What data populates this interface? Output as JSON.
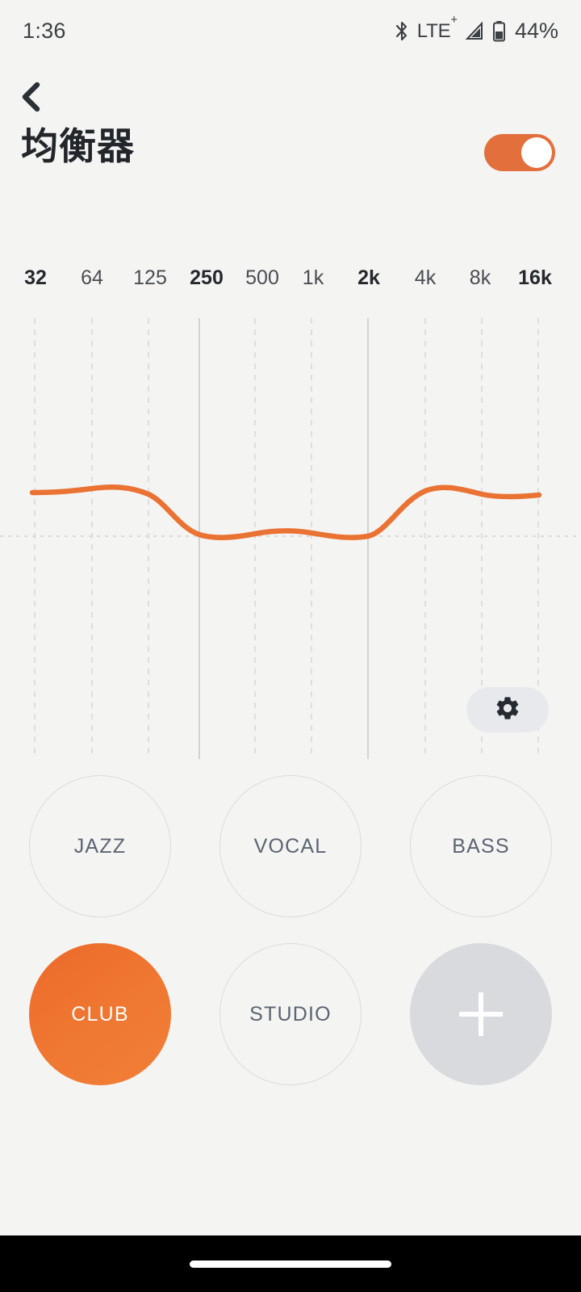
{
  "status_bar": {
    "time": "1:36",
    "bluetooth_icon": "bluetooth-icon",
    "network_label": "LTE",
    "network_superscript": "+",
    "signal_icon": "signal-bars-icon",
    "battery_icon": "battery-icon",
    "battery_percent": "44%"
  },
  "header": {
    "back_icon": "chevron-left-icon",
    "title": "均衡器",
    "toggle_state": "on",
    "toggle_color": "#e3703c"
  },
  "chart_data": {
    "type": "line",
    "title": "",
    "xlabel": "",
    "ylabel": "",
    "categories": [
      "32",
      "64",
      "125",
      "250",
      "500",
      "1k",
      "2k",
      "4k",
      "8k",
      "16k"
    ],
    "major_ticks": [
      "32",
      "250",
      "2k",
      "16k"
    ],
    "solid_gridlines": [
      "250",
      "2k"
    ],
    "values": [
      3.2,
      3.6,
      2.6,
      -0.3,
      0.0,
      0.2,
      -0.4,
      3.7,
      3.2,
      3.3
    ],
    "ylim": [
      -12,
      12
    ],
    "zero_line": 0,
    "grid": true,
    "legend": "none",
    "line_color": "#ea7233",
    "line_width": 6,
    "gridline_color": "#d9d9d9"
  },
  "settings_button": {
    "icon": "gear-icon",
    "background": "#e7e9ec"
  },
  "presets": {
    "rows": [
      [
        {
          "label": "JAZZ",
          "selected": false,
          "type": "preset"
        },
        {
          "label": "VOCAL",
          "selected": false,
          "type": "preset"
        },
        {
          "label": "BASS",
          "selected": false,
          "type": "preset"
        }
      ],
      [
        {
          "label": "CLUB",
          "selected": true,
          "type": "preset"
        },
        {
          "label": "STUDIO",
          "selected": false,
          "type": "preset"
        },
        {
          "label": "",
          "selected": false,
          "type": "add",
          "icon": "plus-icon"
        }
      ]
    ],
    "selected_color": "#ee7430",
    "unselected_border": "#dcdcdc",
    "unselected_text": "#5b6472",
    "add_background": "#d8dadd"
  },
  "nav_bar": {
    "gesture_pill": "home-gesture-pill"
  }
}
